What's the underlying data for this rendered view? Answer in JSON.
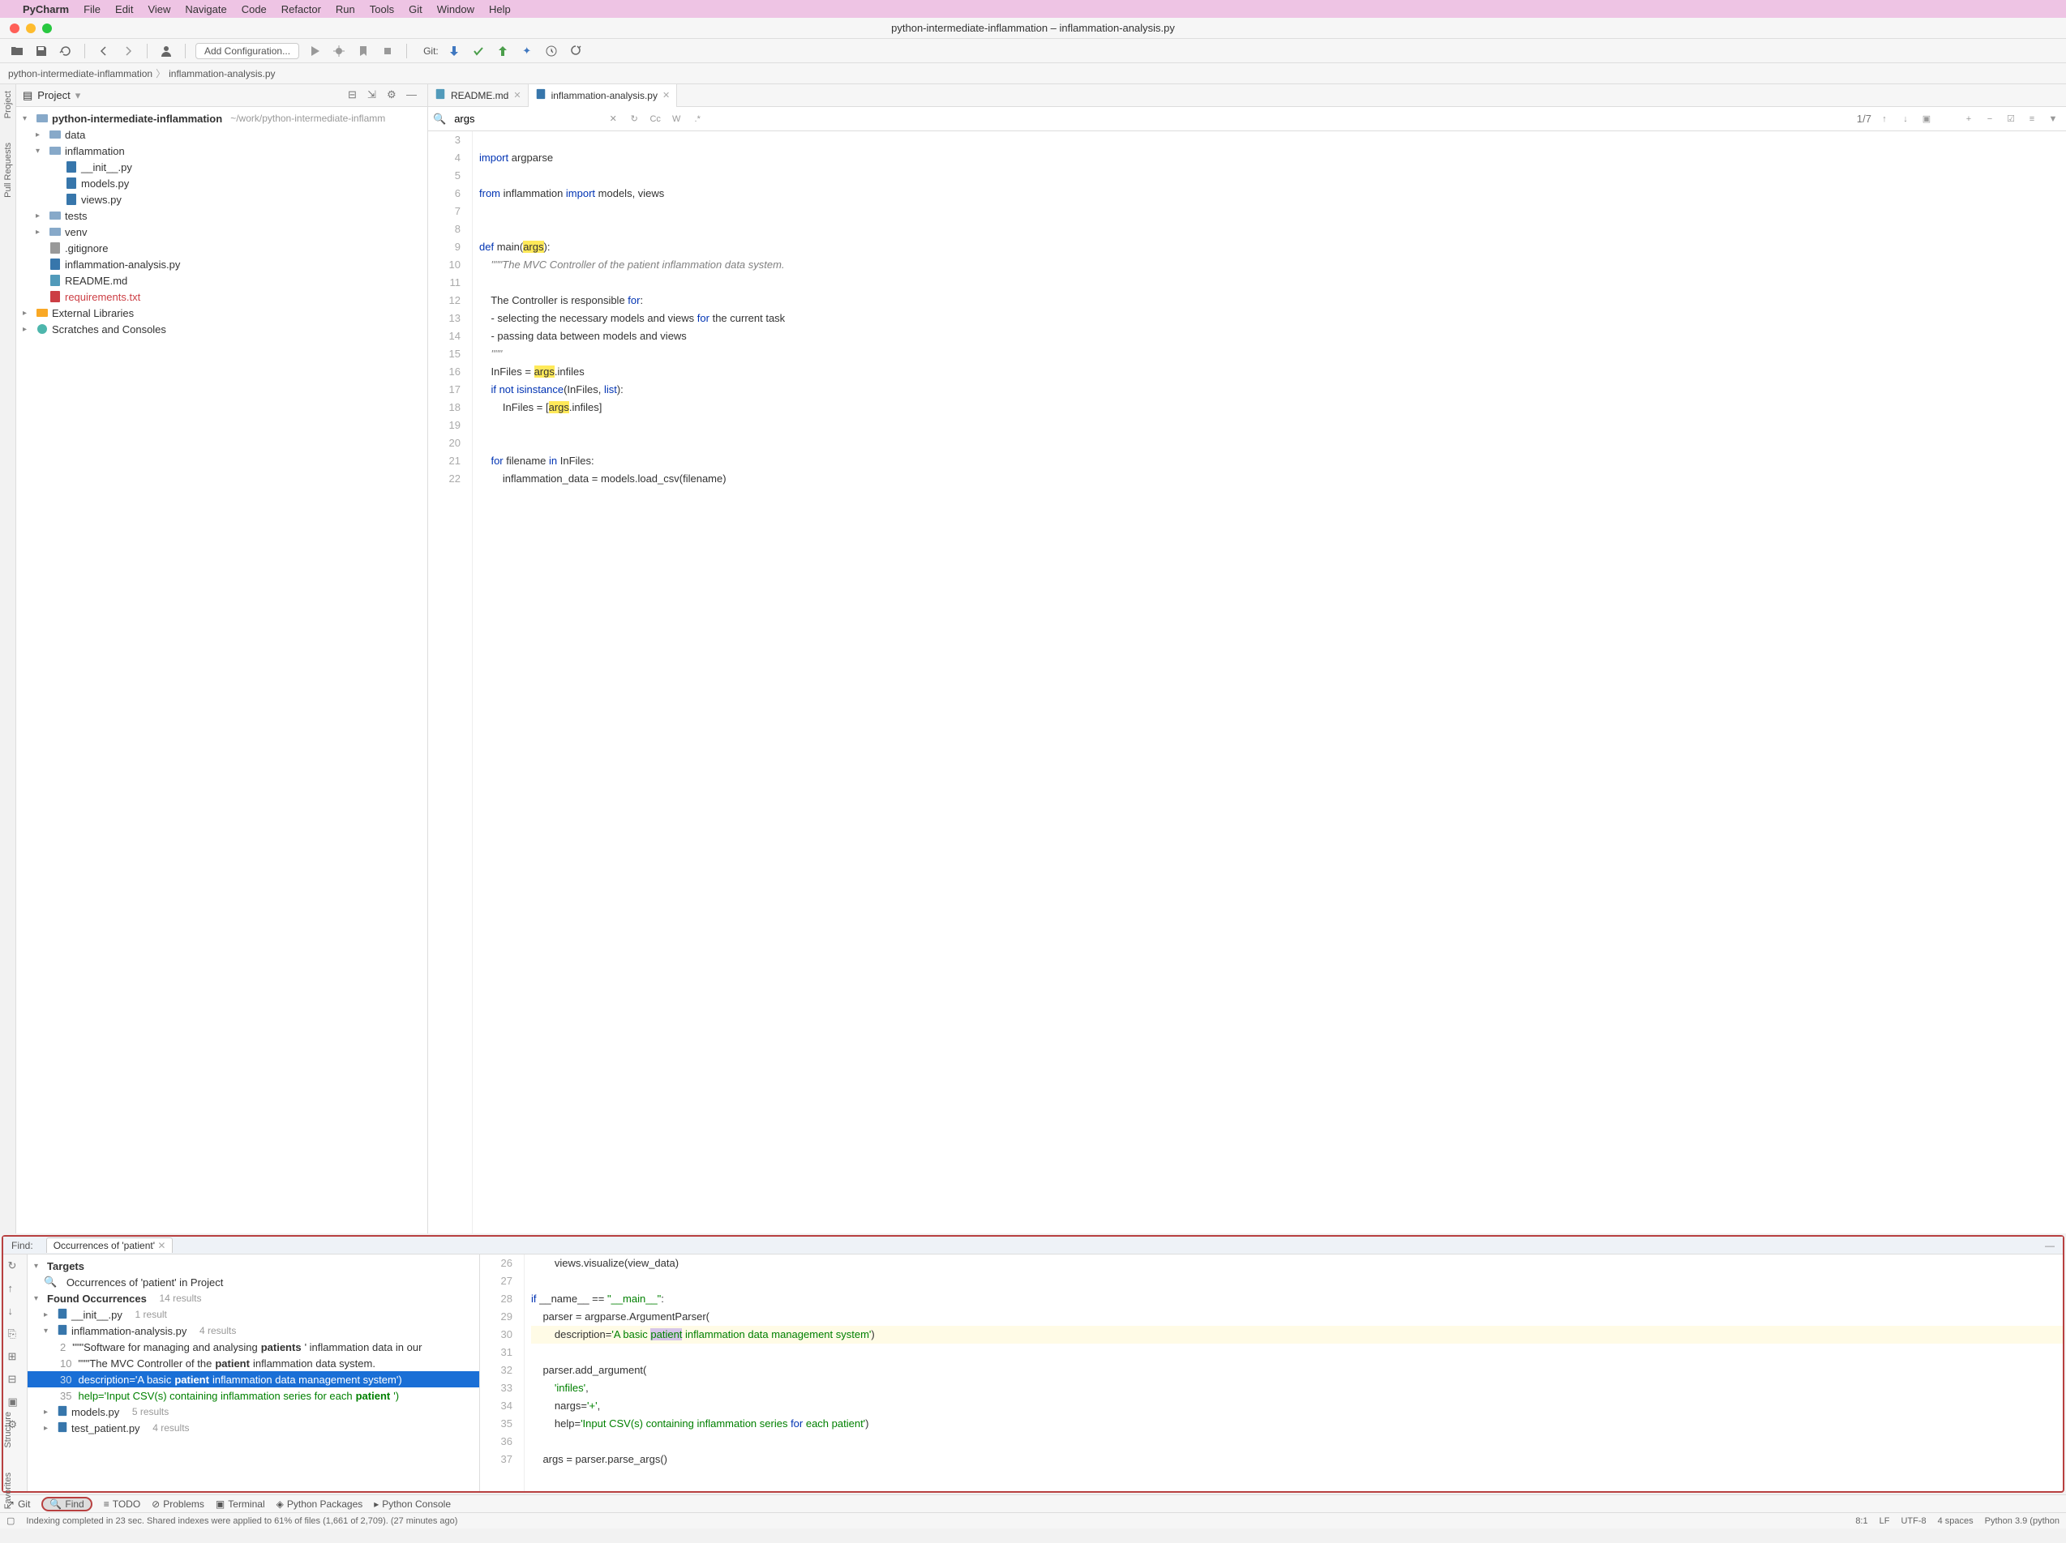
{
  "menubar": {
    "apple": "",
    "app": "PyCharm",
    "items": [
      "File",
      "Edit",
      "View",
      "Navigate",
      "Code",
      "Refactor",
      "Run",
      "Tools",
      "Git",
      "Window",
      "Help"
    ]
  },
  "window": {
    "title": "python-intermediate-inflammation – inflammation-analysis.py"
  },
  "toolbar": {
    "addconf": "Add Configuration...",
    "git": "Git:"
  },
  "breadcrumb": {
    "root": "python-intermediate-inflammation",
    "file": "inflammation-analysis.py"
  },
  "leftrail": {
    "project": "Project",
    "pullreq": "Pull Requests",
    "structure": "Structure",
    "favorites": "Favorites"
  },
  "project": {
    "header": "Project",
    "root": "python-intermediate-inflammation",
    "rootpath": "~/work/python-intermediate-inflamm",
    "items": {
      "data": "data",
      "inflammation": "inflammation",
      "init": "__init__.py",
      "models": "models.py",
      "views": "views.py",
      "tests": "tests",
      "venv": "venv",
      "gitignore": ".gitignore",
      "analysis": "inflammation-analysis.py",
      "readme": "README.md",
      "requirements": "requirements.txt",
      "extlib": "External Libraries",
      "scratches": "Scratches and Consoles"
    }
  },
  "tabs": {
    "readme": "README.md",
    "analysis": "inflammation-analysis.py"
  },
  "find_inline": {
    "query": "args",
    "count": "1/7",
    "cc": "Cc",
    "w": "W"
  },
  "code": {
    "lines": [
      {
        "n": 3,
        "t": ""
      },
      {
        "n": 4,
        "t": "import argparse"
      },
      {
        "n": 5,
        "t": ""
      },
      {
        "n": 6,
        "t": "from inflammation import models, views"
      },
      {
        "n": 7,
        "t": ""
      },
      {
        "n": 8,
        "t": ""
      },
      {
        "n": 9,
        "t": "def main(args):"
      },
      {
        "n": 10,
        "t": "    \"\"\"The MVC Controller of the patient inflammation data system."
      },
      {
        "n": 11,
        "t": ""
      },
      {
        "n": 12,
        "t": "    The Controller is responsible for:"
      },
      {
        "n": 13,
        "t": "    - selecting the necessary models and views for the current task"
      },
      {
        "n": 14,
        "t": "    - passing data between models and views"
      },
      {
        "n": 15,
        "t": "    \"\"\""
      },
      {
        "n": 16,
        "t": "    InFiles = args.infiles"
      },
      {
        "n": 17,
        "t": "    if not isinstance(InFiles, list):"
      },
      {
        "n": 18,
        "t": "        InFiles = [args.infiles]"
      },
      {
        "n": 19,
        "t": ""
      },
      {
        "n": 20,
        "t": ""
      },
      {
        "n": 21,
        "t": "    for filename in InFiles:"
      },
      {
        "n": 22,
        "t": "        inflammation_data = models.load_csv(filename)"
      }
    ]
  },
  "findpanel": {
    "label": "Find:",
    "tab": "Occurrences of 'patient'",
    "targets": "Targets",
    "target_desc": "Occurrences of 'patient' in Project",
    "found": "Found Occurrences",
    "found_cnt": "14 results",
    "files": {
      "init": "__init__.py",
      "init_cnt": "1 result",
      "analysis": "inflammation-analysis.py",
      "analysis_cnt": "4 results",
      "models": "models.py",
      "models_cnt": "5 results",
      "testpatient": "test_patient.py",
      "testpatient_cnt": "4 results"
    },
    "lines": {
      "l2_num": "2",
      "l2_pre": "\"\"\"Software for managing and analysing ",
      "l2_match": "patients",
      "l2_post": "' inflammation data in our",
      "l10_num": "10",
      "l10_pre": "\"\"\"The MVC Controller of the ",
      "l10_match": "patient",
      "l10_post": " inflammation data system.",
      "l30_num": "30",
      "l30_pre": "description='A basic ",
      "l30_match": "patient",
      "l30_post": " inflammation data management system')",
      "l35_num": "35",
      "l35_pre": "help='Input CSV(s) containing inflammation series for each ",
      "l35_match": "patient",
      "l35_post": "')"
    }
  },
  "findcode": {
    "lines": [
      {
        "n": 26,
        "t": "        views.visualize(view_data)"
      },
      {
        "n": 27,
        "t": ""
      },
      {
        "n": 28,
        "t": "if __name__ == \"__main__\":"
      },
      {
        "n": 29,
        "t": "    parser = argparse.ArgumentParser("
      },
      {
        "n": 30,
        "t": "        description='A basic patient inflammation data management system')"
      },
      {
        "n": 31,
        "t": ""
      },
      {
        "n": 32,
        "t": "    parser.add_argument("
      },
      {
        "n": 33,
        "t": "        'infiles',"
      },
      {
        "n": 34,
        "t": "        nargs='+',"
      },
      {
        "n": 35,
        "t": "        help='Input CSV(s) containing inflammation series for each patient')"
      },
      {
        "n": 36,
        "t": ""
      },
      {
        "n": 37,
        "t": "    args = parser.parse_args()"
      }
    ]
  },
  "bottombar": {
    "git": "Git",
    "find": "Find",
    "todo": "TODO",
    "problems": "Problems",
    "terminal": "Terminal",
    "packages": "Python Packages",
    "console": "Python Console"
  },
  "status": {
    "msg": "Indexing completed in 23 sec. Shared indexes were applied to 61% of files (1,661 of 2,709). (27 minutes ago)",
    "pos": "8:1",
    "lf": "LF",
    "enc": "UTF-8",
    "indent": "4 spaces",
    "python": "Python 3.9 (python"
  }
}
